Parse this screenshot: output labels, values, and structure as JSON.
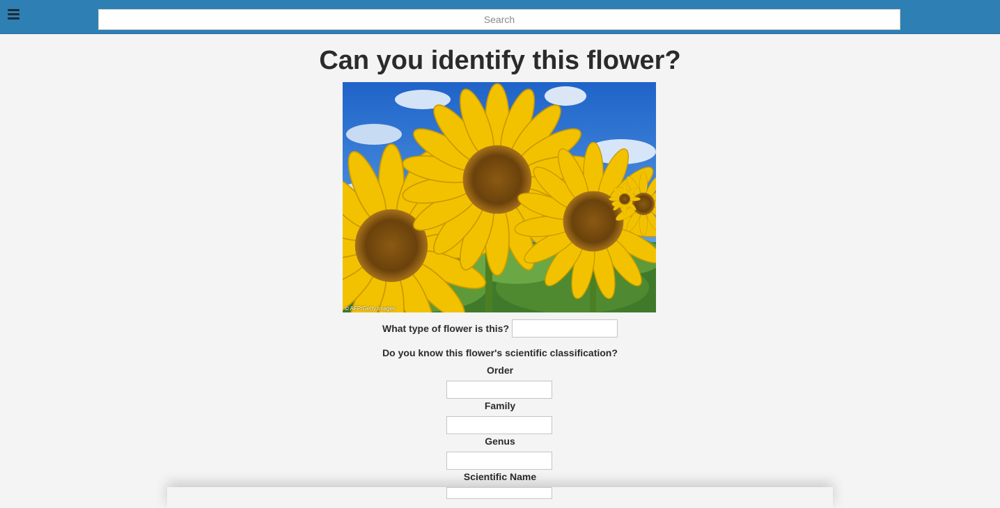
{
  "header": {
    "menu_icon": "hamburger-menu-icon",
    "search_placeholder": "Search",
    "background_color": "#2e7fb3"
  },
  "main": {
    "title": "Can you identify this flower?",
    "photo": {
      "subject": "sunflowers under blue sky",
      "credit": "© AFP/Getty Images"
    },
    "flower_type_label": "What type of flower is this?",
    "classification_prompt": "Do you know this flower's scientific classification?",
    "fields": {
      "order_label": "Order",
      "family_label": "Family",
      "genus_label": "Genus",
      "scientific_name_label": "Scientific Name"
    }
  }
}
